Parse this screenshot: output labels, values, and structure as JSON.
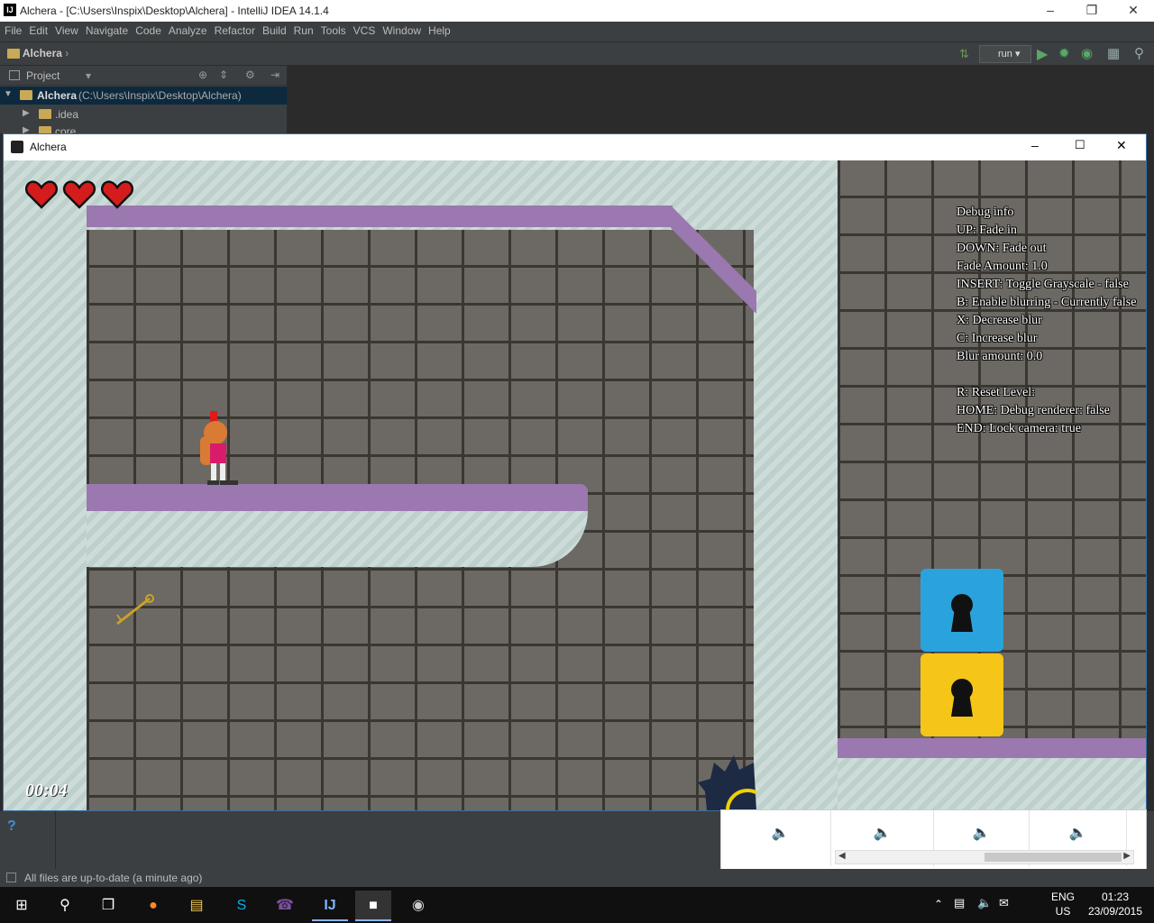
{
  "ide": {
    "window_title": "Alchera - [C:\\Users\\Inspix\\Desktop\\Alchera] - IntelliJ IDEA 14.1.4",
    "menu": [
      "File",
      "Edit",
      "View",
      "Navigate",
      "Code",
      "Analyze",
      "Refactor",
      "Build",
      "Run",
      "Tools",
      "VCS",
      "Window",
      "Help"
    ],
    "breadcrumb": "Alchera",
    "run_config": "run",
    "project_label": "Project",
    "tree": {
      "root_name": "Alchera",
      "root_path": "(C:\\Users\\Inspix\\Desktop\\Alchera)",
      "child1": ".idea",
      "child2": "core"
    },
    "status": "All files are up-to-date (a minute ago)",
    "help_glyph": "?"
  },
  "game": {
    "window_title": "Alchera",
    "lives": 3,
    "timer": "00:04",
    "debug": {
      "lines": [
        "Debug info",
        "UP: Fade in",
        "DOWN: Fade out",
        "Fade Amount: 1.0",
        "INSERT: Toggle Grayscale - false",
        "B: Enable blurring - Currently false",
        "X: Decrease blur",
        "C: Increase blur",
        "Blur amount: 0.0",
        "",
        "R: Reset Level:",
        "HOME: Debug renderer: false",
        "END: Lock camera: true"
      ]
    },
    "lock_colors": [
      "#2aa3dd",
      "#f5c518"
    ]
  },
  "taskbar": {
    "lang": "ENG",
    "region": "US",
    "time": "01:23",
    "date": "23/09/2015"
  }
}
